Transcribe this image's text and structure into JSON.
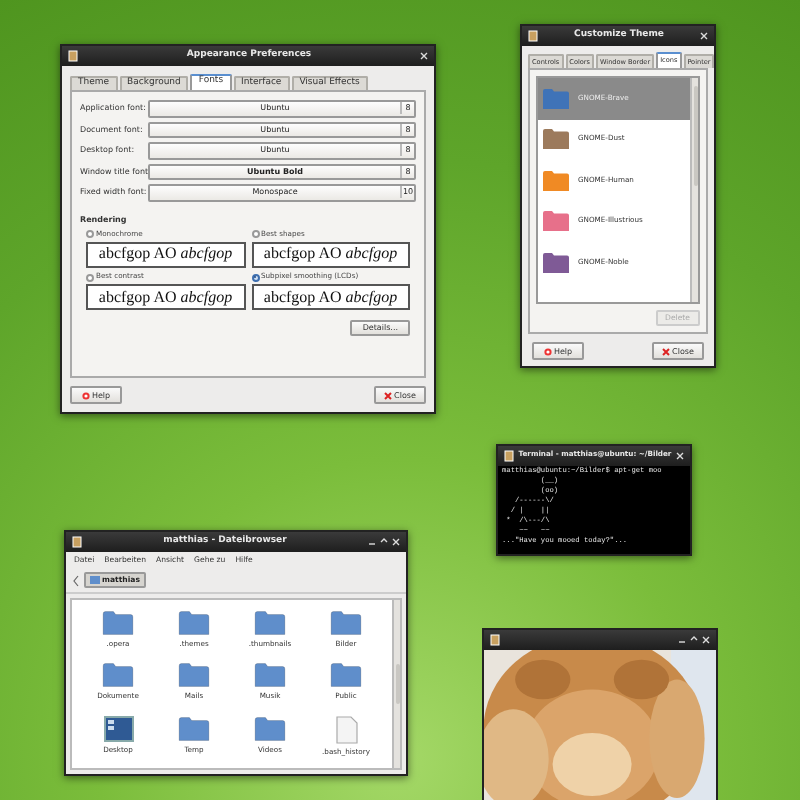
{
  "appearance_window": {
    "title": "Appearance Preferences",
    "tabs": [
      {
        "label": "Theme",
        "selected": false
      },
      {
        "label": "Background",
        "selected": false
      },
      {
        "label": "Fonts",
        "selected": true
      },
      {
        "label": "Interface",
        "selected": false
      },
      {
        "label": "Visual Effects",
        "selected": false
      }
    ],
    "font_rows": [
      {
        "label": "Application font:",
        "value": "Ubuntu",
        "size": "8",
        "bold": false
      },
      {
        "label": "Document font:",
        "value": "Ubuntu",
        "size": "8",
        "bold": false
      },
      {
        "label": "Desktop font:",
        "value": "Ubuntu",
        "size": "8",
        "bold": false
      },
      {
        "label": "Window title font:",
        "value": "Ubuntu Bold",
        "size": "8",
        "bold": true
      },
      {
        "label": "Fixed width font:",
        "value": "Monospace",
        "size": "10",
        "bold": false
      }
    ],
    "section_title": "Rendering",
    "rendering_options": [
      {
        "label": "Monochrome",
        "selected": false,
        "sample": "abcfgop AO *abcfgop*"
      },
      {
        "label": "Best shapes",
        "selected": false,
        "sample": "abcfgop AO *abcfgop*"
      },
      {
        "label": "Best contrast",
        "selected": false,
        "sample": "abcfgop AO *abcfgop*"
      },
      {
        "label": "Subpixel smoothing (LCDs)",
        "selected": true,
        "sample": "abcfgop AO *abcfgop*"
      }
    ],
    "details_button": "Details...",
    "help_button": "Help",
    "close_button": "Close"
  },
  "theme_window": {
    "title": "Customize Theme",
    "tabs": [
      {
        "label": "Controls",
        "selected": false
      },
      {
        "label": "Colors",
        "selected": false
      },
      {
        "label": "Window Border",
        "selected": false
      },
      {
        "label": "Icons",
        "selected": true
      },
      {
        "label": "Pointer",
        "selected": false
      }
    ],
    "themes": [
      {
        "name": "GNOME-Brave",
        "selected": true,
        "color": "#3f73b8"
      },
      {
        "name": "GNOME-Dust",
        "selected": false,
        "color": "#9c7a5c"
      },
      {
        "name": "GNOME-Human",
        "selected": false,
        "color": "#f08a24"
      },
      {
        "name": "GNOME-Illustrious",
        "selected": false,
        "color": "#e7708a"
      },
      {
        "name": "GNOME-Noble",
        "selected": false,
        "color": "#7f5a96"
      }
    ],
    "delete_button": {
      "label": "Delete",
      "disabled": true
    },
    "help_button": "Help",
    "close_button": "Close"
  },
  "terminal": {
    "title": "Terminal - matthias@ubuntu: ~/Bilder",
    "lines": [
      "matthias@ubuntu:~/Bilder$ apt-get moo",
      "         (__)",
      "         (oo)",
      "   /------\\/",
      "  / |    ||",
      " *  /\\---/\\",
      "    ~~   ~~",
      "...\"Have you mooed today?\"..."
    ]
  },
  "file_browser": {
    "title": "matthias - Dateibrowser",
    "menu": [
      "Datei",
      "Bearbeiten",
      "Ansicht",
      "Gehe zu",
      "Hilfe"
    ],
    "path_button": "matthias",
    "files": [
      {
        "name": ".opera",
        "kind": "folder"
      },
      {
        "name": ".themes",
        "kind": "folder"
      },
      {
        "name": ".thumbnails",
        "kind": "folder"
      },
      {
        "name": "Bilder",
        "kind": "folder"
      },
      {
        "name": "Dokumente",
        "kind": "folder"
      },
      {
        "name": "Mails",
        "kind": "folder"
      },
      {
        "name": "Musik",
        "kind": "folder"
      },
      {
        "name": "Public",
        "kind": "folder"
      },
      {
        "name": "Desktop",
        "kind": "desktop"
      },
      {
        "name": "Temp",
        "kind": "folder"
      },
      {
        "name": "Videos",
        "kind": "folder"
      },
      {
        "name": ".bash_history",
        "kind": "document"
      }
    ]
  }
}
